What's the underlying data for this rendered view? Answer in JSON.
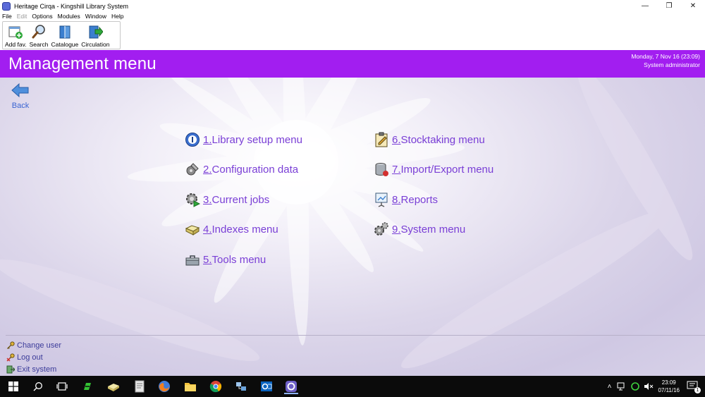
{
  "window": {
    "title": "Heritage Cirqa - Kingshill Library System",
    "controls": {
      "minimize": "—",
      "restore": "❐",
      "close": "✕"
    }
  },
  "menubar": [
    "File",
    "Edit",
    "Options",
    "Modules",
    "Window",
    "Help"
  ],
  "toolbar": {
    "buttons": [
      {
        "label": "Add fav.",
        "icon": "add-favourite-icon"
      },
      {
        "label": "Search",
        "icon": "search-icon"
      },
      {
        "label": "Catalogue",
        "icon": "catalogue-icon"
      },
      {
        "label": "Circulation",
        "icon": "circulation-icon"
      }
    ]
  },
  "header": {
    "title": "Management menu",
    "date": "Monday, 7 Nov 16  (23:09)",
    "user": "System administrator",
    "color": "#a21ef0"
  },
  "back": {
    "label": "Back"
  },
  "menu": {
    "left": [
      {
        "num": "1.",
        "text": " Library setup menu",
        "icon": "library-setup-icon"
      },
      {
        "num": "2.",
        "text": " Configuration data",
        "icon": "configuration-icon"
      },
      {
        "num": "3.",
        "text": " Current jobs",
        "icon": "current-jobs-icon"
      },
      {
        "num": "4.",
        "text": " Indexes menu",
        "icon": "indexes-icon"
      },
      {
        "num": "5.",
        "text": " Tools menu",
        "icon": "tools-icon"
      }
    ],
    "right": [
      {
        "num": "6.",
        "text": " Stocktaking menu",
        "icon": "stocktaking-icon"
      },
      {
        "num": "7.",
        "text": " Import/Export menu",
        "icon": "import-export-icon"
      },
      {
        "num": "8.",
        "text": " Reports",
        "icon": "reports-icon"
      },
      {
        "num": "9.",
        "text": " System menu",
        "icon": "system-menu-icon"
      }
    ]
  },
  "footer": [
    {
      "label": "Change user",
      "icon": "key-icon"
    },
    {
      "label": "Log out",
      "icon": "log-out-icon"
    },
    {
      "label": "Exit system",
      "icon": "exit-icon"
    }
  ],
  "taskbar": {
    "time": "23:09",
    "date": "07/11/16",
    "notifications": "1",
    "apps": [
      "start-icon",
      "search-icon",
      "task-view-icon",
      "app-green-icon",
      "app-book-icon",
      "app-document-icon",
      "firefox-icon",
      "file-explorer-icon",
      "chrome-icon",
      "app-network-icon",
      "outlook-icon",
      "heritage-cirqa-icon"
    ]
  }
}
